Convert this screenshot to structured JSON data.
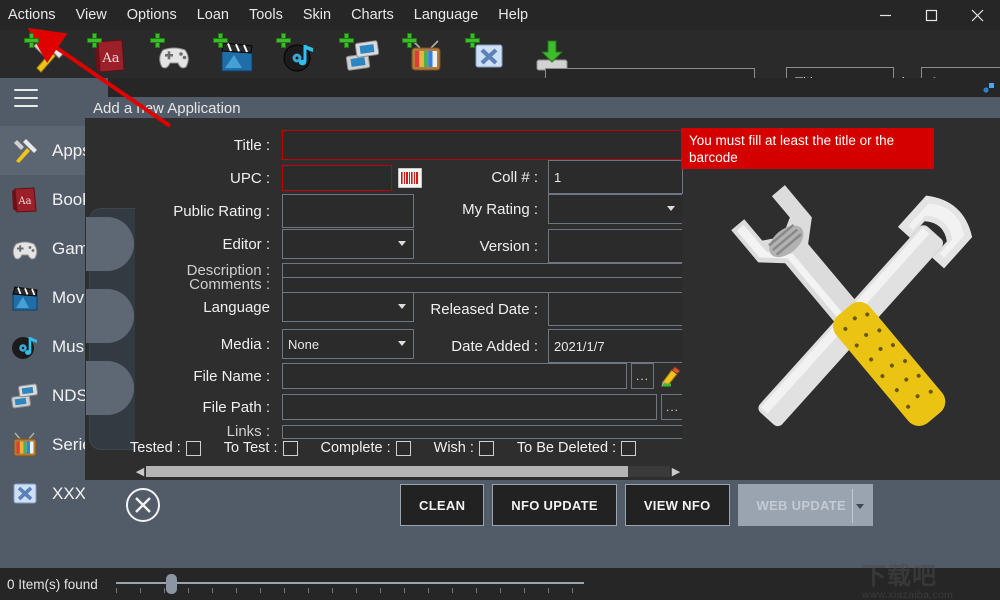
{
  "window": {
    "controls": [
      {
        "name": "minimize",
        "glyph": "minimize-icon"
      },
      {
        "name": "maximize",
        "glyph": "maximize-icon"
      },
      {
        "name": "close",
        "glyph": "close-icon"
      }
    ]
  },
  "menubar": {
    "items": [
      {
        "label": "Actions"
      },
      {
        "label": "View"
      },
      {
        "label": "Options"
      },
      {
        "label": "Loan"
      },
      {
        "label": "Tools"
      },
      {
        "label": "Skin"
      },
      {
        "label": "Charts"
      },
      {
        "label": "Language"
      },
      {
        "label": "Help"
      }
    ]
  },
  "toolbar": {
    "buttons": [
      {
        "name": "add-application",
        "icon": "tools-icon"
      },
      {
        "name": "add-book",
        "icon": "book-icon"
      },
      {
        "name": "add-game",
        "icon": "gamepad-icon"
      },
      {
        "name": "add-movie",
        "icon": "movie-clapper-icon"
      },
      {
        "name": "add-music",
        "icon": "music-disc-icon"
      },
      {
        "name": "add-nds",
        "icon": "nds-console-icon"
      },
      {
        "name": "add-series",
        "icon": "television-icon"
      },
      {
        "name": "add-xxx",
        "icon": "x-folder-icon"
      },
      {
        "name": "import",
        "icon": "download-icon"
      }
    ]
  },
  "search": {
    "value": "",
    "placeholder": "",
    "as_label": "as",
    "criteria": "Title",
    "in_label": "in",
    "collection": "Apps"
  },
  "sidebar": {
    "items": [
      {
        "label": "Apps",
        "icon": "tools-icon",
        "active": true
      },
      {
        "label": "Books",
        "icon": "book-icon",
        "active": false
      },
      {
        "label": "Games",
        "icon": "gamepad-icon",
        "active": false
      },
      {
        "label": "Movies",
        "icon": "movie-clapper-icon",
        "active": false
      },
      {
        "label": "Music",
        "icon": "music-disc-icon",
        "active": false
      },
      {
        "label": "NDS",
        "icon": "nds-console-icon",
        "active": false
      },
      {
        "label": "Series",
        "icon": "television-icon",
        "active": false
      },
      {
        "label": "XXX",
        "icon": "x-folder-icon",
        "active": false
      }
    ]
  },
  "page": {
    "title": "Add a new Application"
  },
  "form": {
    "title_label": "Title :",
    "title_value": "",
    "upc_label": "UPC :",
    "upc_value": "",
    "public_rating_label": "Public Rating :",
    "public_rating_value": "",
    "editor_label": "Editor :",
    "editor_value": "",
    "description_label": "Description :",
    "description_value": "",
    "comments_label": "Comments :",
    "comments_value": "",
    "language_label": "Language",
    "language_value": "",
    "media_label": "Media :",
    "media_value": "None",
    "file_name_label": "File Name :",
    "file_name_value": "",
    "file_path_label": "File Path :",
    "file_path_value": "",
    "links_label": "Links :",
    "links_value": "",
    "coll_label": "Coll # :",
    "coll_value": "1",
    "my_rating_label": "My Rating :",
    "my_rating_value": "",
    "version_label": "Version :",
    "version_value": "",
    "released_date_label": "Released Date :",
    "released_date_value": "",
    "date_added_label": "Date Added :",
    "date_added_value": "2021/1/7",
    "browse_label": "...",
    "checkboxes": [
      {
        "label": "Tested :",
        "checked": false
      },
      {
        "label": "To Test :",
        "checked": false
      },
      {
        "label": "Complete :",
        "checked": false
      },
      {
        "label": "Wish :",
        "checked": false
      },
      {
        "label": "To Be Deleted :",
        "checked": false
      }
    ]
  },
  "error": {
    "message": "You must fill at least the title or the barcode",
    "color": "#d40000"
  },
  "footer": {
    "close_icon": "close-circle-icon",
    "buttons": [
      {
        "label": "CLEAN",
        "disabled": false
      },
      {
        "label": "NFO UPDATE",
        "disabled": false
      },
      {
        "label": "VIEW NFO",
        "disabled": false
      },
      {
        "label": "WEB UPDATE",
        "disabled": true
      }
    ]
  },
  "statusbar": {
    "items_found": "0 Item(s) found",
    "slider_value": 11
  },
  "watermark": {
    "text": "下载吧",
    "url": "www.xiazaiba.com"
  }
}
